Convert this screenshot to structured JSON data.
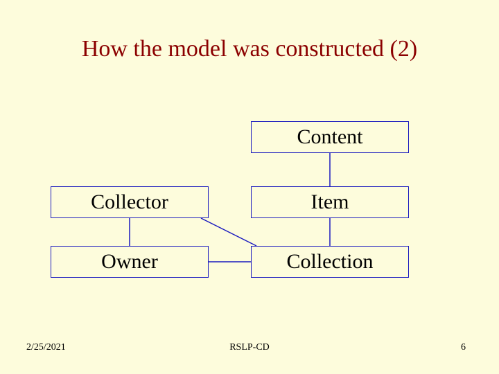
{
  "title": "How the model was constructed (2)",
  "boxes": {
    "content": "Content",
    "collector": "Collector",
    "item": "Item",
    "owner": "Owner",
    "collection": "Collection"
  },
  "footer": {
    "date": "2/25/2021",
    "center": "RSLP-CD",
    "page": "6"
  },
  "colors": {
    "background": "#fdfcdc",
    "title": "#8b0000",
    "boxBorder": "#1a1abf"
  }
}
